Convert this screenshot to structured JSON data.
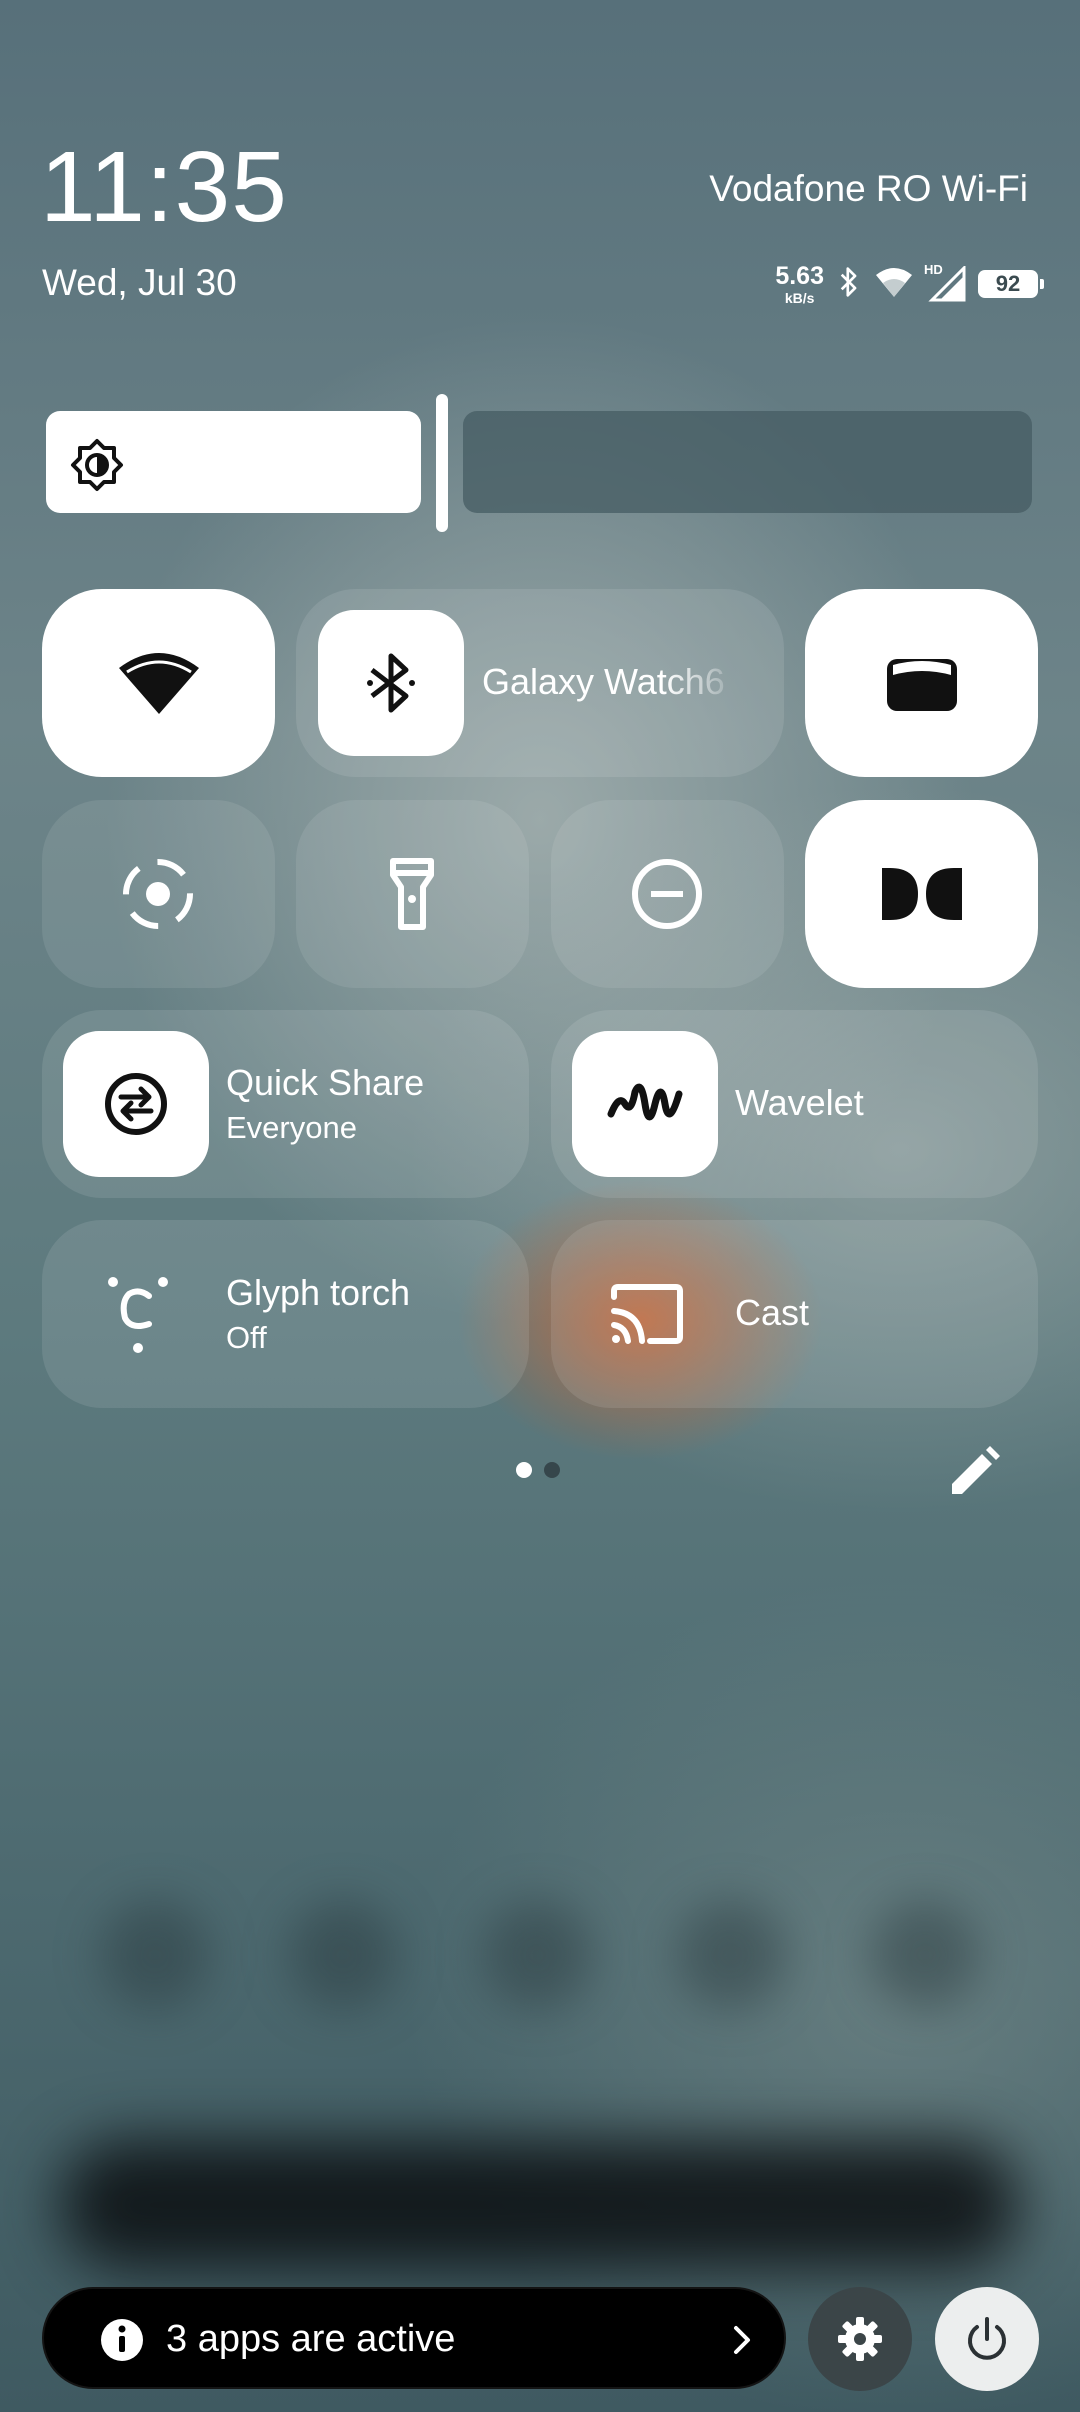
{
  "status": {
    "time": "11:35",
    "date": "Wed, Jul 30",
    "carrier": "Vodafone RO Wi-Fi",
    "net_speed_value": "5.63",
    "net_speed_unit": "kB/s",
    "network_type": "HD",
    "battery_level": "92"
  },
  "brightness": {
    "level": 0.38,
    "icon": "brightness-icon"
  },
  "tiles": {
    "wifi": {
      "icon": "wifi-icon",
      "state": "on"
    },
    "bluetooth": {
      "icon": "bluetooth-icon",
      "label": "Galaxy Watch6",
      "state": "on"
    },
    "wallet": {
      "icon": "wallet-icon",
      "state": "on"
    },
    "auto_rotate": {
      "icon": "auto-rotate-icon",
      "state": "off"
    },
    "flashlight": {
      "icon": "flashlight-icon",
      "state": "off"
    },
    "do_not_disturb": {
      "icon": "do-not-disturb-icon",
      "state": "off"
    },
    "dolby": {
      "icon": "dolby-icon",
      "state": "on"
    },
    "quick_share": {
      "icon": "quick-share-icon",
      "label": "Quick Share",
      "sublabel": "Everyone",
      "state": "on"
    },
    "wavelet": {
      "icon": "wavelet-icon",
      "label": "Wavelet",
      "state": "on"
    },
    "glyph_torch": {
      "icon": "glyph-torch-icon",
      "label": "Glyph torch",
      "sublabel": "Off",
      "state": "off"
    },
    "cast": {
      "icon": "cast-icon",
      "label": "Cast",
      "state": "off"
    }
  },
  "pager": {
    "current_page": 1,
    "total_pages": 2
  },
  "footer": {
    "active_apps_text": "3 apps are active"
  },
  "colors": {
    "tile_active": "#ffffff",
    "pill_background": "#000000",
    "accent_orange": "#d66028"
  }
}
